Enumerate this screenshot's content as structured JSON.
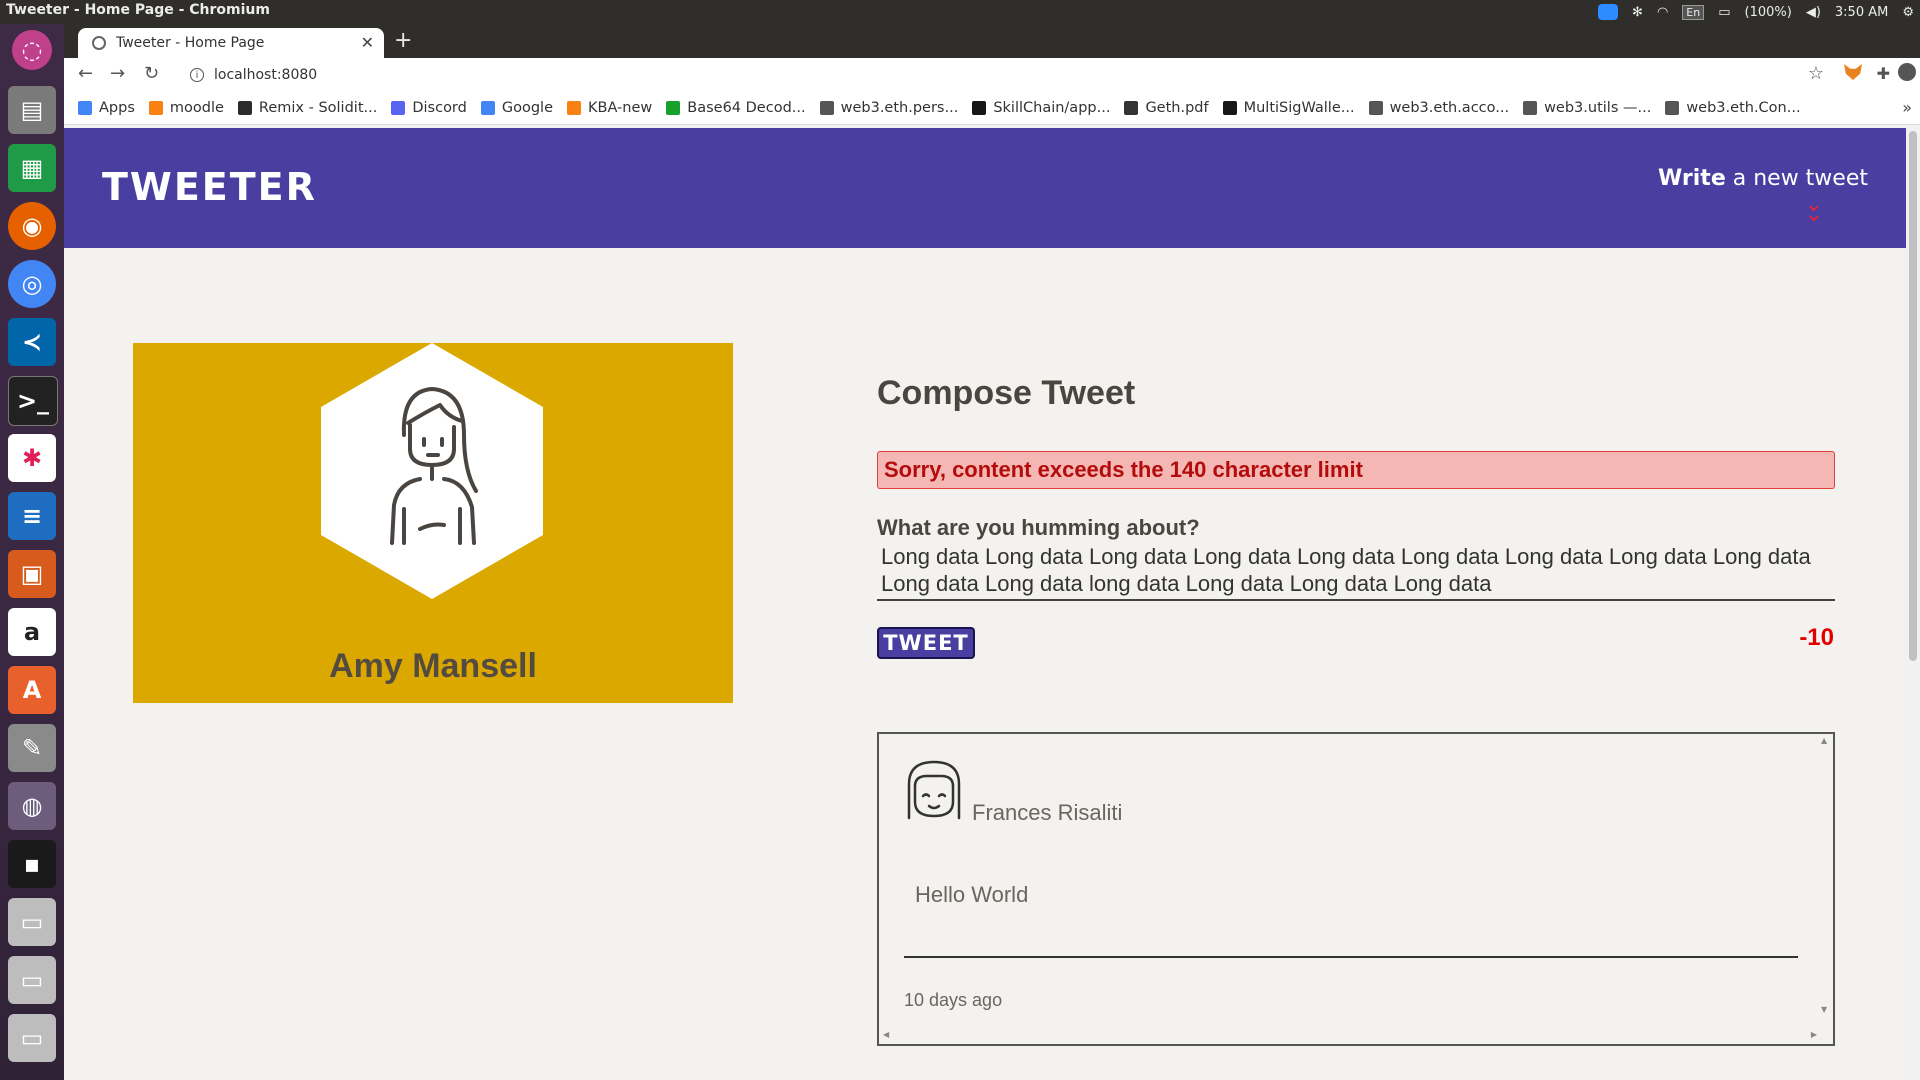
{
  "os": {
    "window_title": "Tweeter - Home Page - Chromium",
    "battery": "(100%)",
    "lang": "En",
    "clock": "3:50 AM"
  },
  "browser": {
    "tab_title": "Tweeter - Home Page",
    "url": "localhost:8080",
    "bookmarks": [
      {
        "label": "Apps",
        "color": "#4285f4"
      },
      {
        "label": "moodle",
        "color": "#f98012"
      },
      {
        "label": "Remix - Solidit...",
        "color": "#2c2c2c"
      },
      {
        "label": "Discord",
        "color": "#5865f2"
      },
      {
        "label": "Google",
        "color": "#4285f4"
      },
      {
        "label": "KBA-new",
        "color": "#f98012"
      },
      {
        "label": "Base64 Decod...",
        "color": "#17a12b"
      },
      {
        "label": "web3.eth.pers...",
        "color": "#555555"
      },
      {
        "label": "SkillChain/app...",
        "color": "#181717"
      },
      {
        "label": "Geth.pdf",
        "color": "#333333"
      },
      {
        "label": "MultiSigWalle...",
        "color": "#181717"
      },
      {
        "label": "web3.eth.acco...",
        "color": "#555555"
      },
      {
        "label": "web3.utils —...",
        "color": "#555555"
      },
      {
        "label": "web3.eth.Con...",
        "color": "#555555"
      }
    ]
  },
  "app": {
    "brand": "TWEETER",
    "nav_write_bold": "Write",
    "nav_write_rest": " a new tweet",
    "accent_color": "#4a3ea0",
    "profile": {
      "name": "Amy Mansell",
      "card_color": "#dba800"
    },
    "compose": {
      "title": "Compose Tweet",
      "error": "Sorry, content exceeds the 140 character limit",
      "label": "What are you humming about?",
      "text": "Long data Long data Long data Long data Long data Long data Long data Long data Long data Long data Long data long data Long data Long data Long data",
      "button": "TWEET",
      "counter": "-10"
    },
    "tweets": [
      {
        "author": "Frances Risaliti",
        "content": "Hello World",
        "time": "10 days ago"
      }
    ]
  }
}
